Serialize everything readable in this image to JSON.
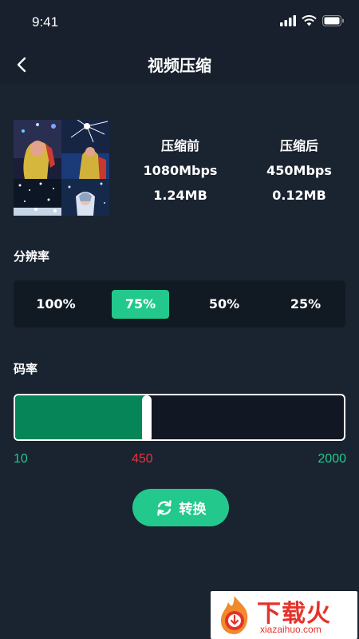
{
  "status_bar": {
    "time": "9:41"
  },
  "header": {
    "title": "视频压缩"
  },
  "before": {
    "label": "压缩前",
    "bitrate": "1080Mbps",
    "size": "1.24MB"
  },
  "after": {
    "label": "压缩后",
    "bitrate": "450Mbps",
    "size": "0.12MB"
  },
  "resolution": {
    "label": "分辨率",
    "options": [
      "100%",
      "75%",
      "50%",
      "25%"
    ],
    "selected": "75%"
  },
  "bitrate": {
    "label": "码率",
    "min": "10",
    "current": "450",
    "max": "2000",
    "fill_fraction": 0.4
  },
  "convert_button": {
    "label": "转换"
  },
  "watermark": {
    "text": "下载火",
    "sub": "xiazaihuo.com"
  },
  "colors": {
    "accent": "#23c98c",
    "current_value": "#e5353f",
    "background": "#1a2330"
  }
}
